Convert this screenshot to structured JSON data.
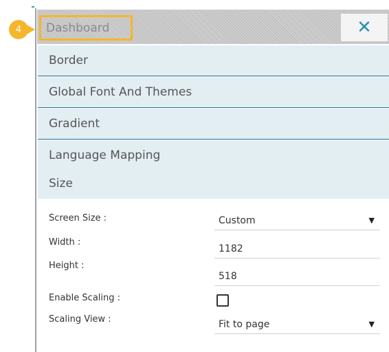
{
  "header": {
    "title": "Dashboard",
    "close_glyph": "✕",
    "step_badge": "4",
    "highlight_color": "#f5b62b",
    "close_color": "#2f8fb0"
  },
  "sections": [
    {
      "label": "Border"
    },
    {
      "label": "Global Font And Themes"
    },
    {
      "label": "Gradient"
    },
    {
      "label": "Language Mapping"
    },
    {
      "label": "Size"
    }
  ],
  "size_form": {
    "screen_size": {
      "label": "Screen Size :",
      "value": "Custom"
    },
    "width": {
      "label": "Width :",
      "value": "1182"
    },
    "height": {
      "label": "Height :",
      "value": "518"
    },
    "enable_scaling": {
      "label": "Enable Scaling :",
      "checked": false
    },
    "scaling_view": {
      "label": "Scaling View :",
      "value": "Fit to page"
    },
    "dropdown_glyph": "▼"
  }
}
